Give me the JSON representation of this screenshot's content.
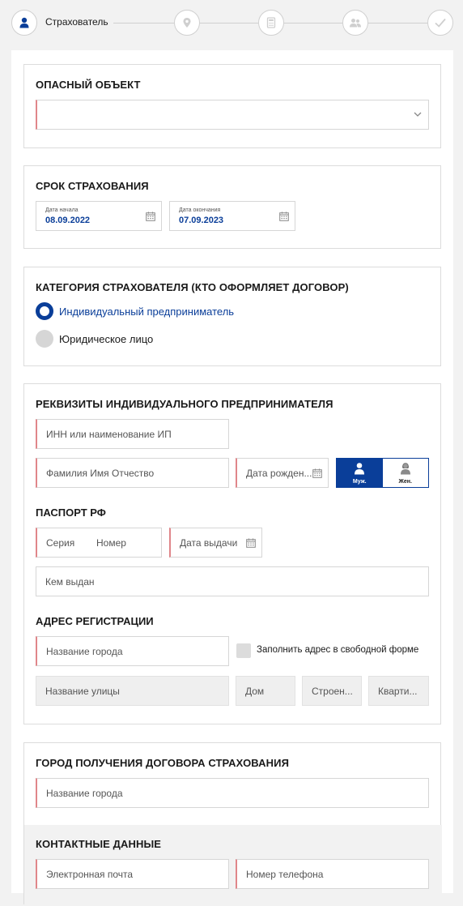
{
  "stepper": {
    "current_label": "Страхователь",
    "steps": [
      {
        "icon": "person-icon",
        "active": true
      },
      {
        "icon": "location-pin-icon",
        "active": false
      },
      {
        "icon": "calculator-icon",
        "active": false
      },
      {
        "icon": "people-icon",
        "active": false
      },
      {
        "icon": "checkmark-icon",
        "active": false
      }
    ]
  },
  "hazard": {
    "title": "ОПАСНЫЙ ОБЪЕКТ",
    "select_value": ""
  },
  "term": {
    "title": "СРОК СТРАХОВАНИЯ",
    "start_label": "Дата начала",
    "start_value": "08.09.2022",
    "end_label": "Дата окончания",
    "end_value": "07.09.2023"
  },
  "category": {
    "title": "КАТЕГОРИЯ СТРАХОВАТЕЛЯ (КТО ОФОРМЛЯЕТ ДОГОВОР)",
    "options": [
      {
        "label": "Индивидуальный предприниматель",
        "selected": true
      },
      {
        "label": "Юридическое лицо",
        "selected": false
      }
    ]
  },
  "details": {
    "title": "РЕКВИЗИТЫ ИНДИВИДУАЛЬНОГО ПРЕДПРИНИМАТЕЛЯ",
    "inn_placeholder": "ИНН или наименование ИП",
    "fio_placeholder": "Фамилия Имя Отчество",
    "birth_placeholder": "Дата рожден...",
    "gender_male": "Муж.",
    "gender_female": "Жен.",
    "gender_selected": "male",
    "passport_title": "ПАСПОРТ РФ",
    "series_placeholder": "Серия",
    "number_placeholder": "Номер",
    "issue_date_placeholder": "Дата выдачи",
    "issued_by_placeholder": "Кем выдан",
    "address_title": "АДРЕС РЕГИСТРАЦИИ",
    "city_placeholder": "Название города",
    "free_form_label": "Заполнить адрес в свободной форме",
    "street_placeholder": "Название улицы",
    "house_placeholder": "Дом",
    "building_placeholder": "Строен...",
    "apartment_placeholder": "Кварти..."
  },
  "contract_city": {
    "title": "ГОРОД ПОЛУЧЕНИЯ ДОГОВОРА СТРАХОВАНИЯ",
    "city_placeholder": "Название города"
  },
  "contacts": {
    "title": "КОНТАКТНЫЕ ДАННЫЕ",
    "email_placeholder": "Электронная почта",
    "phone_placeholder": "Номер телефона"
  },
  "colors": {
    "accent": "#0a3e99",
    "required_marker": "#e0868a",
    "border": "#d6d6d6"
  }
}
